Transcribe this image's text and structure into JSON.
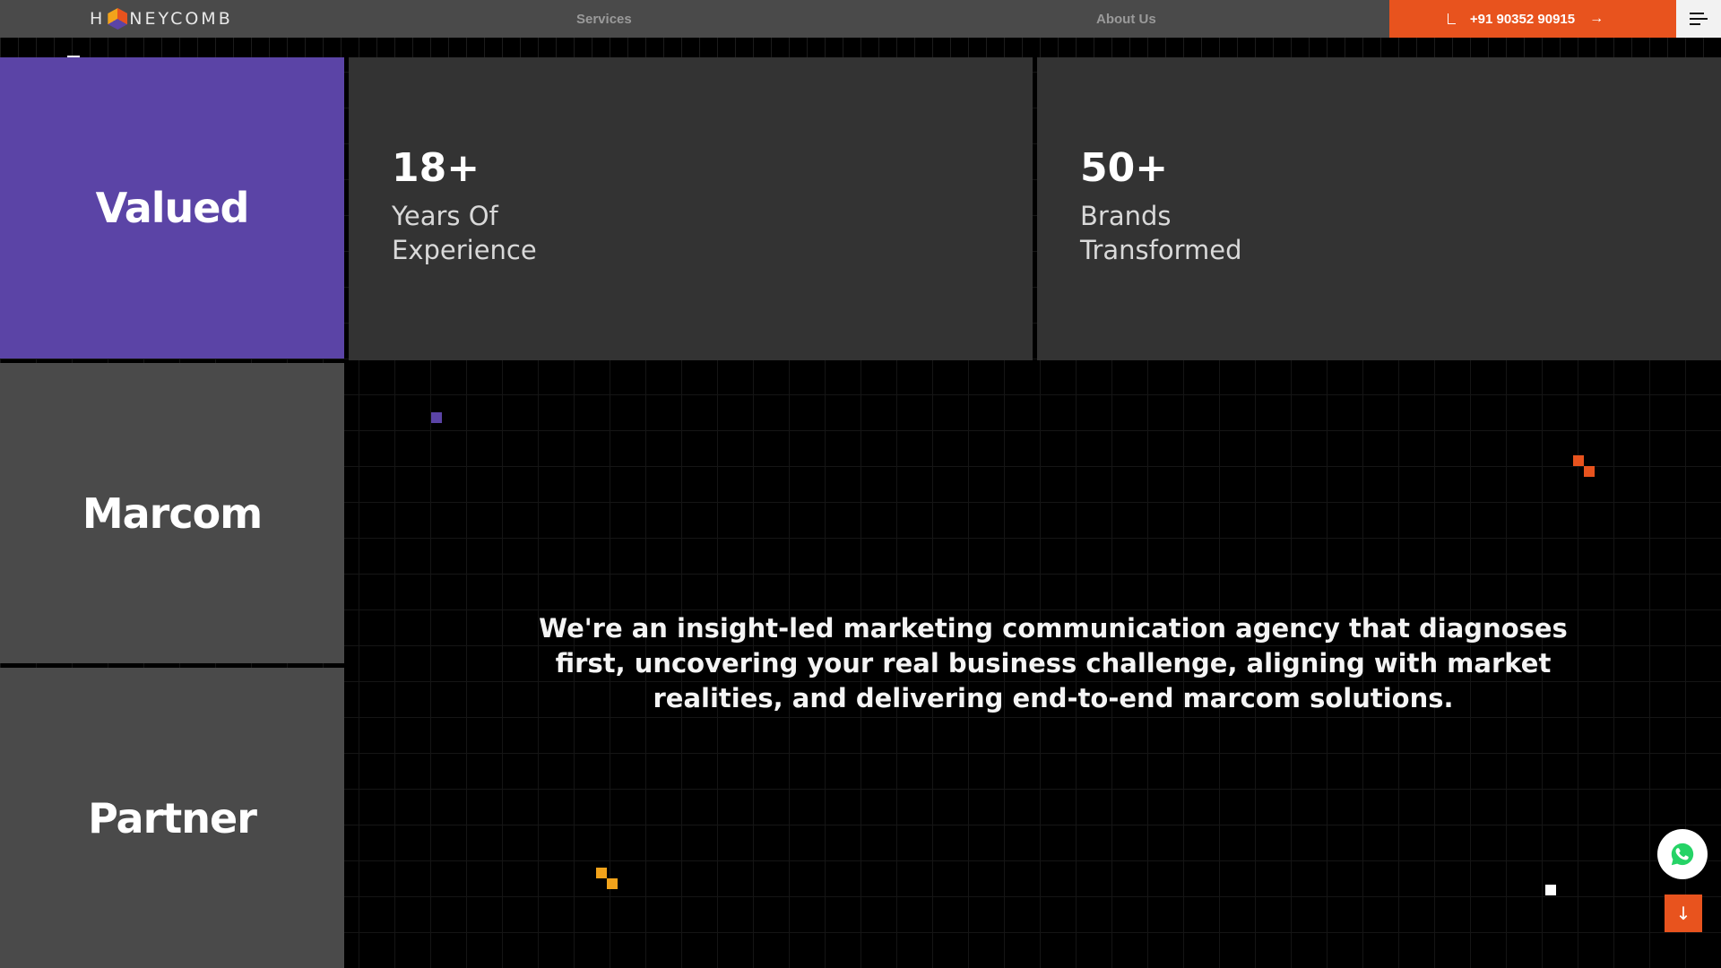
{
  "header": {
    "logo_prefix": "H",
    "logo_suffix": "NEYCOMB",
    "nav": {
      "services": "Services",
      "about": "About Us"
    },
    "phone": "+91 90352 90915",
    "arrow": "→"
  },
  "tiles": {
    "valued": "Valued",
    "marcom": "Marcom",
    "partner": "Partner"
  },
  "stats": [
    {
      "value": "18+",
      "label": "Years Of\nExperience"
    },
    {
      "value": "50+",
      "label": "Brands\nTransformed"
    }
  ],
  "tagline": "We're an insight-led marketing communication agency that diagnoses first, uncovering your real business challenge, aligning with market realities, and delivering end-to-end marcom solutions.",
  "scroll_arrow": "↓",
  "icons": [
    "logo-hex-icon",
    "arrow-right-icon",
    "menu-icon",
    "whatsapp-icon",
    "arrow-down-icon"
  ],
  "colors": {
    "accent": "#e8531e",
    "purple": "#5b44a6",
    "yellow": "#f2a31b",
    "tile_gray": "#4a4a4a",
    "stat_bg": "#333333"
  }
}
